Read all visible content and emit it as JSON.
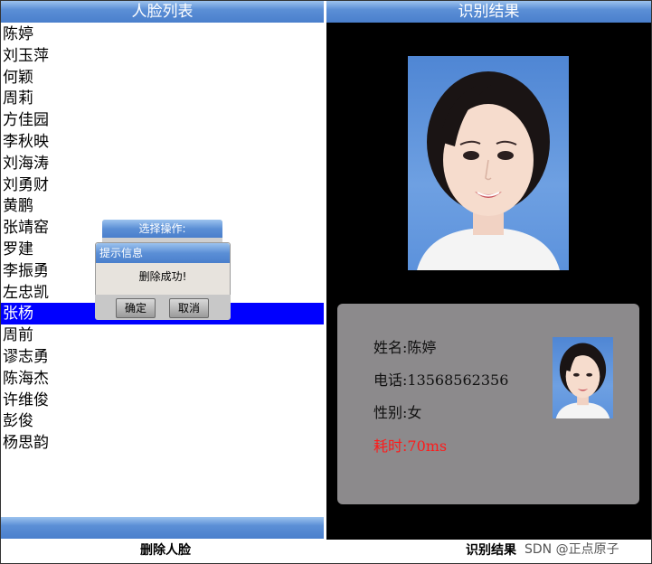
{
  "left_panel": {
    "title": "人脸列表",
    "faces": [
      "陈婷",
      "刘玉萍",
      "何颖",
      "周莉",
      "方佳园",
      "李秋映",
      "刘海涛",
      "刘勇财",
      "黄鹏",
      "张靖窑",
      "罗建",
      "李振勇",
      "左忠凯",
      "张杨",
      "周前",
      "谬志勇",
      "陈海杰",
      "许维俊",
      "彭俊",
      "杨思韵"
    ],
    "selected_index": 13
  },
  "select_dialog": {
    "title": "选择操作:"
  },
  "info_dialog": {
    "title": "提示信息",
    "message": "删除成功!",
    "ok_label": "确定",
    "cancel_label": "取消"
  },
  "right_panel": {
    "title": "识别结果",
    "result": {
      "name_line": "姓名:陈婷",
      "phone_line": "电话:13568562356",
      "gender_line": "性别:女",
      "time_line": "耗时:70ms"
    }
  },
  "captions": {
    "left": "删除人脸",
    "right": "识别结果",
    "watermark": "SDN @正点原子"
  },
  "colors": {
    "header_blue": "#5b8fd6",
    "selected_row": "#0000ff",
    "time_text": "#ff1a1a",
    "card_gray": "#8c8a8c"
  }
}
